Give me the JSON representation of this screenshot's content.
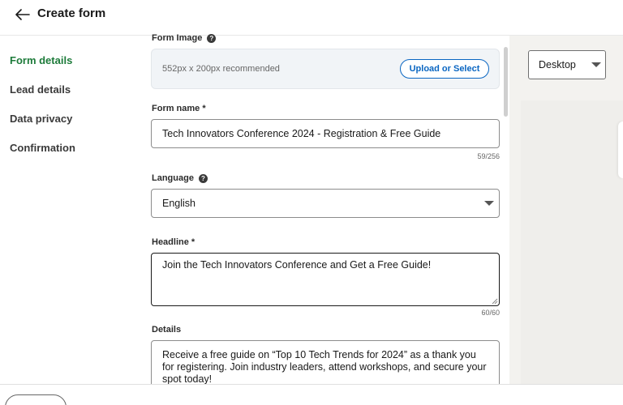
{
  "header": {
    "title": "Create form"
  },
  "sidebar": {
    "items": [
      {
        "label": "Form details",
        "active": true
      },
      {
        "label": "Lead details",
        "active": false
      },
      {
        "label": "Data privacy",
        "active": false
      },
      {
        "label": "Confirmation",
        "active": false
      }
    ]
  },
  "form": {
    "image": {
      "label": "Form Image",
      "hint": "552px x 200px recommended",
      "button_label": "Upload or Select"
    },
    "form_name": {
      "label": "Form name *",
      "value": "Tech Innovators Conference 2024 - Registration & Free Guide",
      "counter": "59/256"
    },
    "language": {
      "label": "Language",
      "value": "English"
    },
    "headline": {
      "label": "Headline *",
      "value": "Join the Tech Innovators Conference and Get a Free Guide!",
      "counter": "60/60"
    },
    "details": {
      "label": "Details",
      "value": "Receive a free guide on “Top 10 Tech Trends for 2024” as a thank you for registering. Join industry leaders, attend workshops, and secure your spot today!"
    }
  },
  "preview": {
    "device": "Desktop"
  },
  "colors": {
    "active_nav": "#1d7b3a",
    "link_blue": "#0a66c2"
  },
  "icons": {
    "back": "arrow-left-icon",
    "help": "help-circle-icon",
    "dropdown": "chevron-down-icon"
  }
}
